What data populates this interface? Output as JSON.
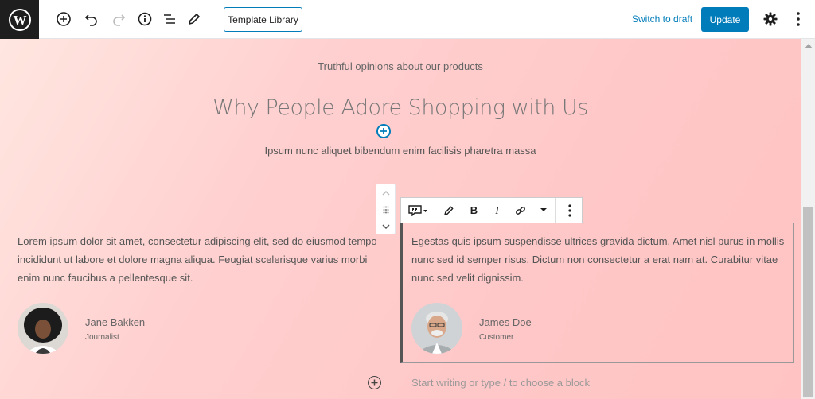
{
  "toolbar": {
    "template_library_label": "Template Library",
    "switch_to_draft_label": "Switch to draft",
    "update_label": "Update",
    "icons": [
      "wordpress-icon",
      "add-block-icon",
      "undo-icon",
      "redo-icon",
      "info-icon",
      "block-navigation-icon",
      "edit-tools-icon",
      "settings-gear-icon",
      "more-menu-icon"
    ]
  },
  "content": {
    "eyebrow": "Truthful opinions about our products",
    "heading": "Why People Adore Shopping with Us",
    "subheading": "Ipsum nunc aliquet bibendum enim facilisis pharetra massa",
    "testimonials": [
      {
        "lines": [
          "Lorem ipsum dolor sit amet, consectetur adipiscing elit, sed do eiusmod tempo",
          "incididunt ut labore et dolore magna aliqua. Feugiat scelerisque varius morbi",
          "enim nunc faucibus a pellentesque sit."
        ],
        "name": "Jane Bakken",
        "role": "Journalist"
      },
      {
        "lines": [
          "Egestas quis ipsum suspendisse ultrices gravida dictum. Amet nisl purus in mollis",
          "nunc sed id semper risus. Dictum non consectetur a erat nam at. Curabitur vitae",
          "nunc sed velit dignissim."
        ],
        "name": "James Doe",
        "role": "Customer"
      }
    ],
    "placeholder": "Start writing or type / to choose a block"
  },
  "block_toolbar": {
    "bold": "B",
    "italic": "I"
  }
}
